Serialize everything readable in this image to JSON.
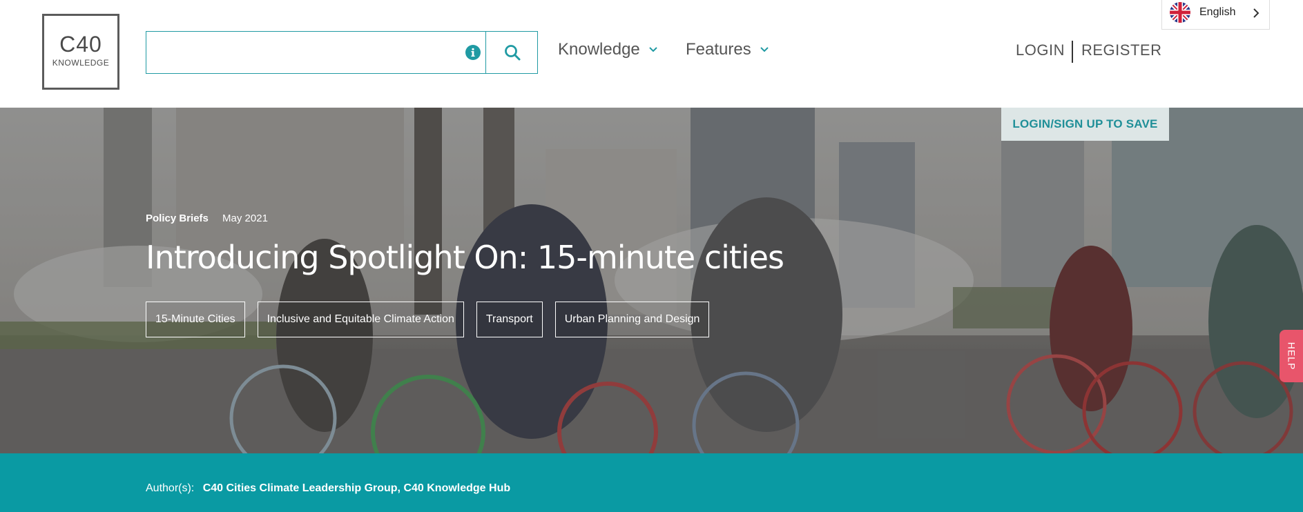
{
  "logo": {
    "main": "C40",
    "sub": "KNOWLEDGE"
  },
  "search": {
    "value": "",
    "placeholder": ""
  },
  "icons": {
    "info": "info-icon",
    "search": "search-icon",
    "chevron": "chevron-down-icon",
    "flag": "uk-flag-icon",
    "lang_chevron": "chevron-right-icon"
  },
  "nav": {
    "items": [
      {
        "label": "Knowledge"
      },
      {
        "label": "Features"
      }
    ]
  },
  "auth": {
    "login": "LOGIN",
    "register": "REGISTER"
  },
  "language": {
    "label": "English"
  },
  "hero": {
    "save_label": "LOGIN/SIGN UP TO SAVE",
    "type": "Policy Briefs",
    "date": "May 2021",
    "title": "Introducing Spotlight On: 15-minute cities",
    "tags": [
      "15-Minute Cities",
      "Inclusive and Equitable Climate Action",
      "Transport",
      "Urban Planning and Design"
    ]
  },
  "help": {
    "label": "HELP"
  },
  "author": {
    "label": "Author(s):",
    "names": "C40 Cities Climate Leadership Group, C40 Knowledge Hub"
  },
  "colors": {
    "teal": "#1f9aa3",
    "author_bar": "#0a9aa3",
    "save_bg": "#dde6e6",
    "help_bg": "#e8556b"
  }
}
